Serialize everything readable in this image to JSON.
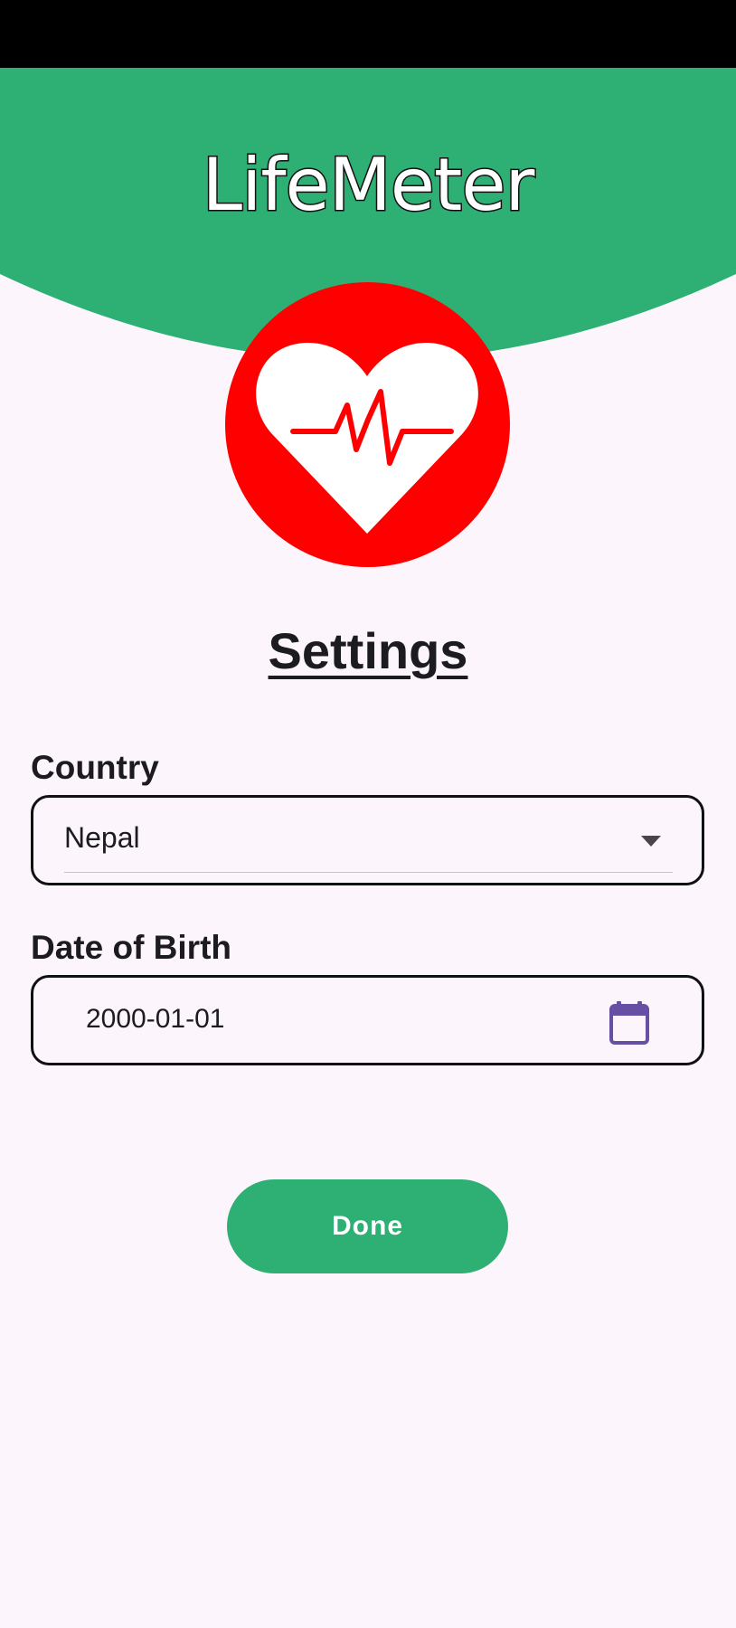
{
  "app": {
    "title": "LifeMeter"
  },
  "page": {
    "title": "Settings"
  },
  "country": {
    "label": "Country",
    "selected": "Nepal"
  },
  "dob": {
    "label": "Date of Birth",
    "value": "2000-01-01"
  },
  "actions": {
    "done_label": "Done"
  },
  "icons": {
    "logo": "heart-pulse-logo-icon",
    "dropdown": "caret-down-icon",
    "calendar": "calendar-icon"
  },
  "colors": {
    "brand_green": "#2eb074",
    "background": "#fcf5fc",
    "logo_red": "#ff0000",
    "calendar_purple": "#6750a4",
    "text": "#1c1b1f"
  }
}
